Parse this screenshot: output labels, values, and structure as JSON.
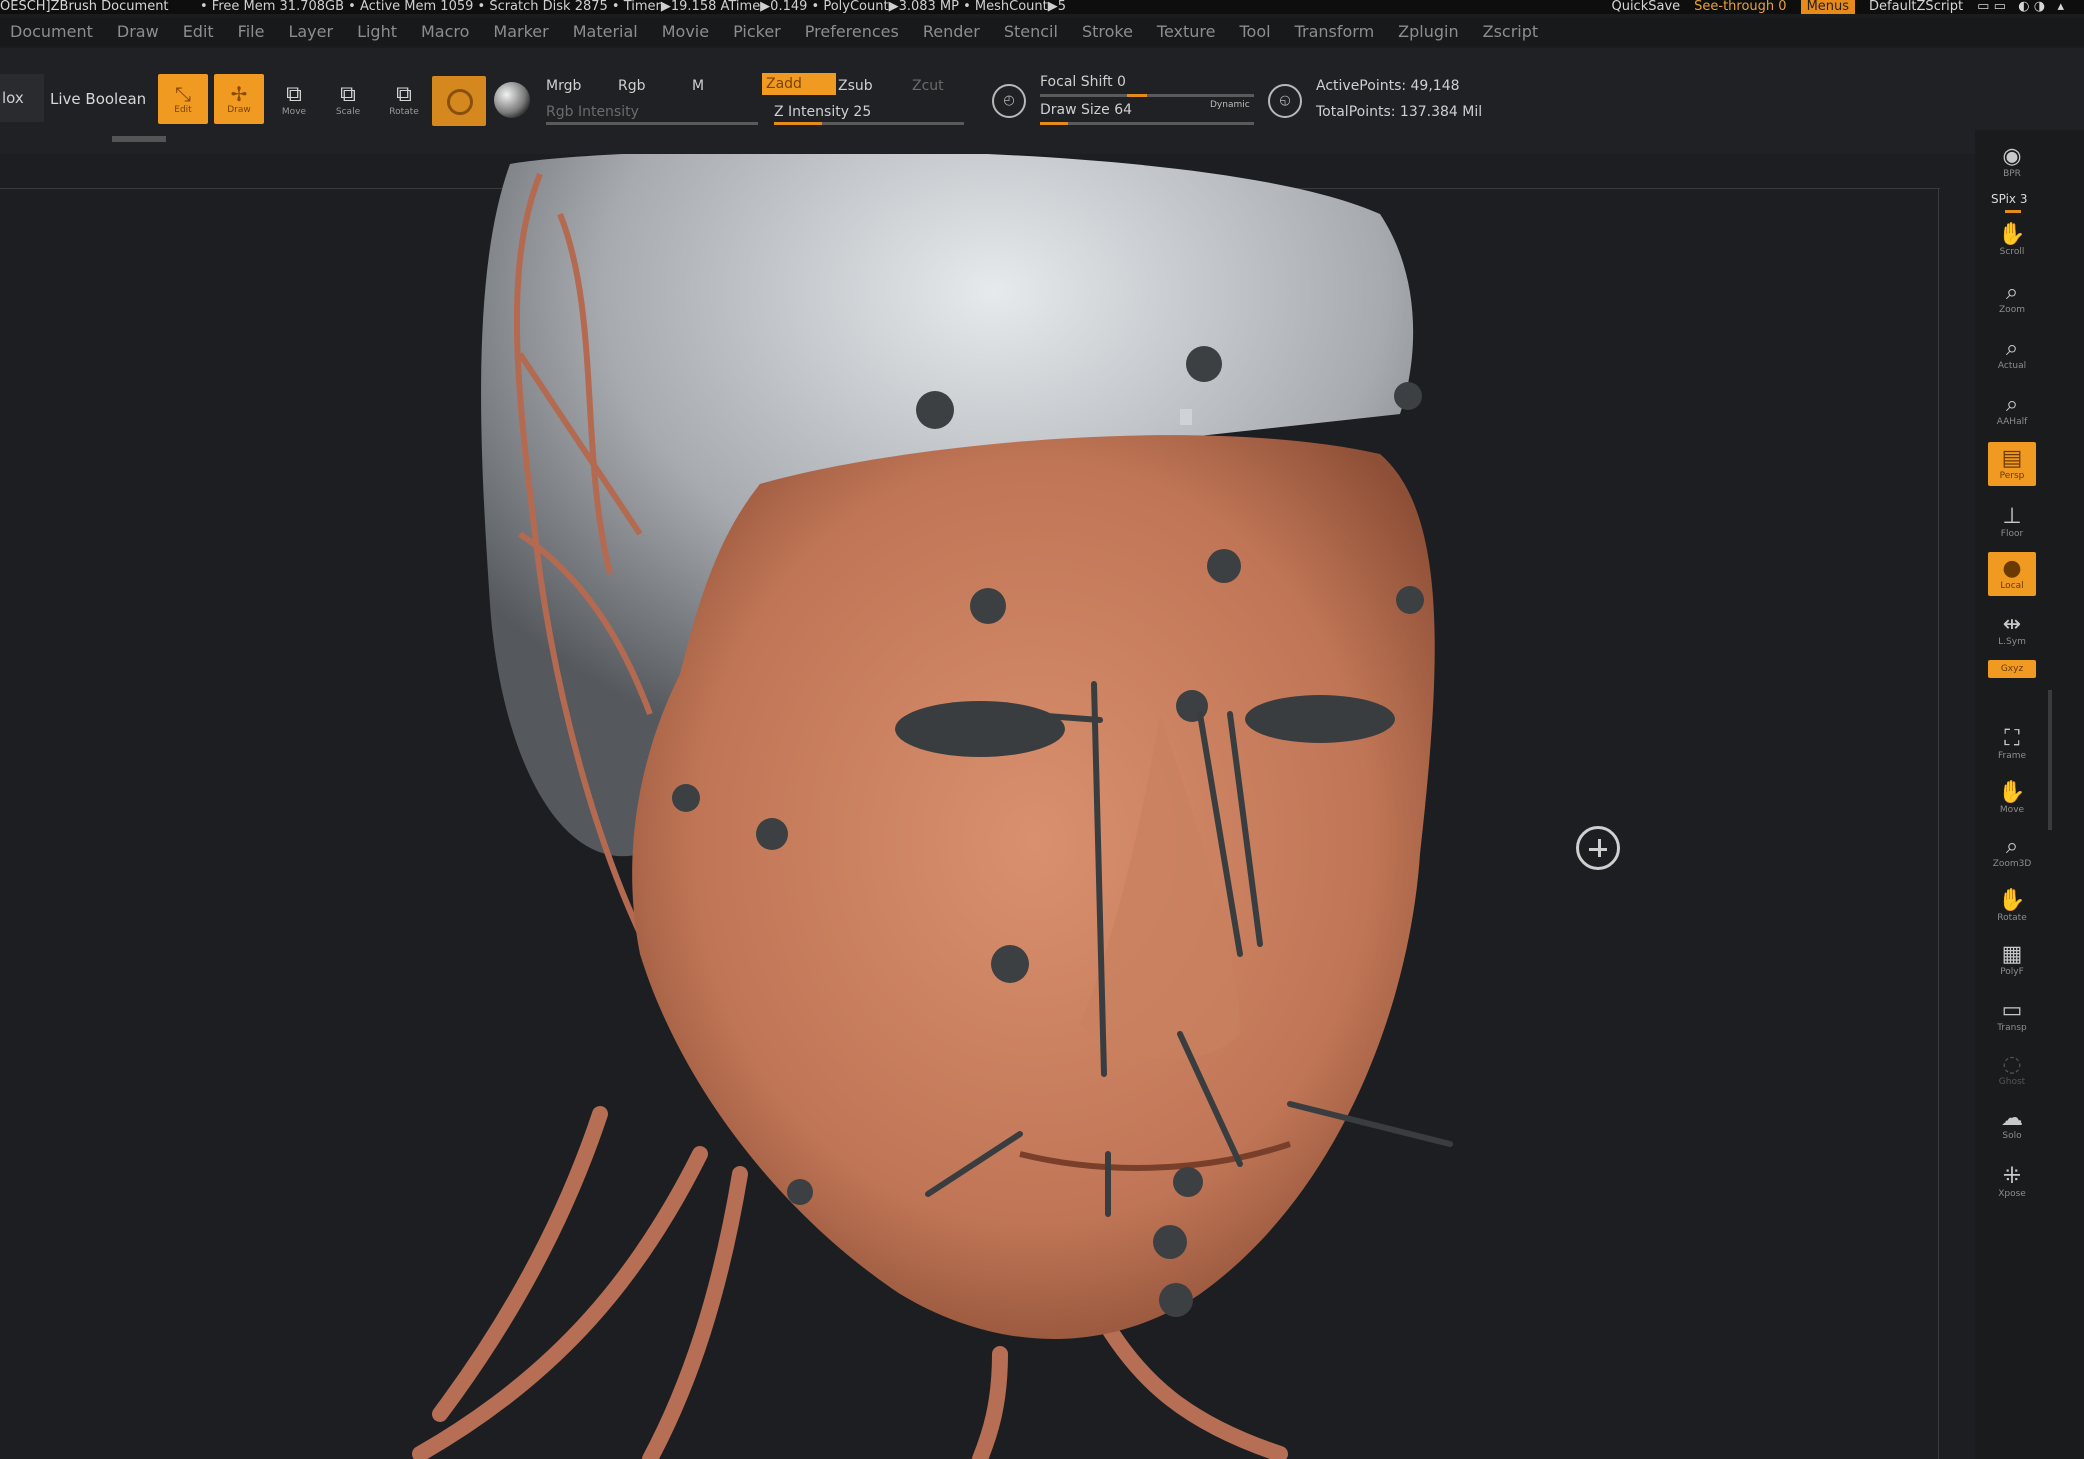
{
  "titlebar": {
    "document": "OESCH]ZBrush Document",
    "stats": "• Free Mem 31.708GB • Active Mem 1059 • Scratch Disk 2875 • Timer▶19.158 ATime▶0.149 • PolyCount▶3.083 MP • MeshCount▶5",
    "quicksave": "QuickSave",
    "see_through": "See-through  0",
    "menus": "Menus",
    "default_zscript": "DefaultZScript"
  },
  "menubar": {
    "items": [
      "Document",
      "Draw",
      "Edit",
      "File",
      "Layer",
      "Light",
      "Macro",
      "Marker",
      "Material",
      "Movie",
      "Picker",
      "Preferences",
      "Render",
      "Stencil",
      "Stroke",
      "Texture",
      "Tool",
      "Transform",
      "Zplugin",
      "Zscript"
    ]
  },
  "toolbar": {
    "box_label": "lox",
    "live_boolean": "Live Boolean",
    "edit_label": "Edit",
    "draw_label": "Draw",
    "move_label": "Move",
    "scale_label": "Scale",
    "rotate_label": "Rotate",
    "mrgb": "Mrgb",
    "rgb": "Rgb",
    "m": "M",
    "rgb_intensity": "Rgb Intensity",
    "zadd": "Zadd",
    "zsub": "Zsub",
    "zcut": "Zcut",
    "z_intensity": "Z Intensity 25",
    "z_intensity_value": 0.25,
    "focal_shift": "Focal Shift 0",
    "focal_shift_value": 0.5,
    "draw_size": "Draw Size 64",
    "draw_size_value": 0.13,
    "dynamic": "Dynamic",
    "active_points": "ActivePoints: 49,148",
    "total_points": "TotalPoints: 137.384 Mil"
  },
  "viewport": {
    "skin_color": "#c87c5e",
    "skull_color": "#bfc3c7",
    "muscle_color": "#b66e55",
    "marker_color": "#3d4042"
  },
  "shelf": {
    "bpr": "BPR",
    "spix": "SPix 3",
    "scroll": "Scroll",
    "zoom": "Zoom",
    "actual": "Actual",
    "aahalf": "AAHalf",
    "persp": "Persp",
    "floor": "Floor",
    "local": "Local",
    "lsym": "L.Sym",
    "xyz": "Gxyz",
    "frame": "Frame",
    "move": "Move",
    "zoom3d": "Zoom3D",
    "rotate": "Rotate",
    "polyf": "PolyF",
    "transp": "Transp",
    "ghost": "Ghost",
    "solo": "Solo",
    "xpose": "Xpose"
  },
  "colors": {
    "accent": "#f09a22",
    "background": "#1d1e21"
  }
}
